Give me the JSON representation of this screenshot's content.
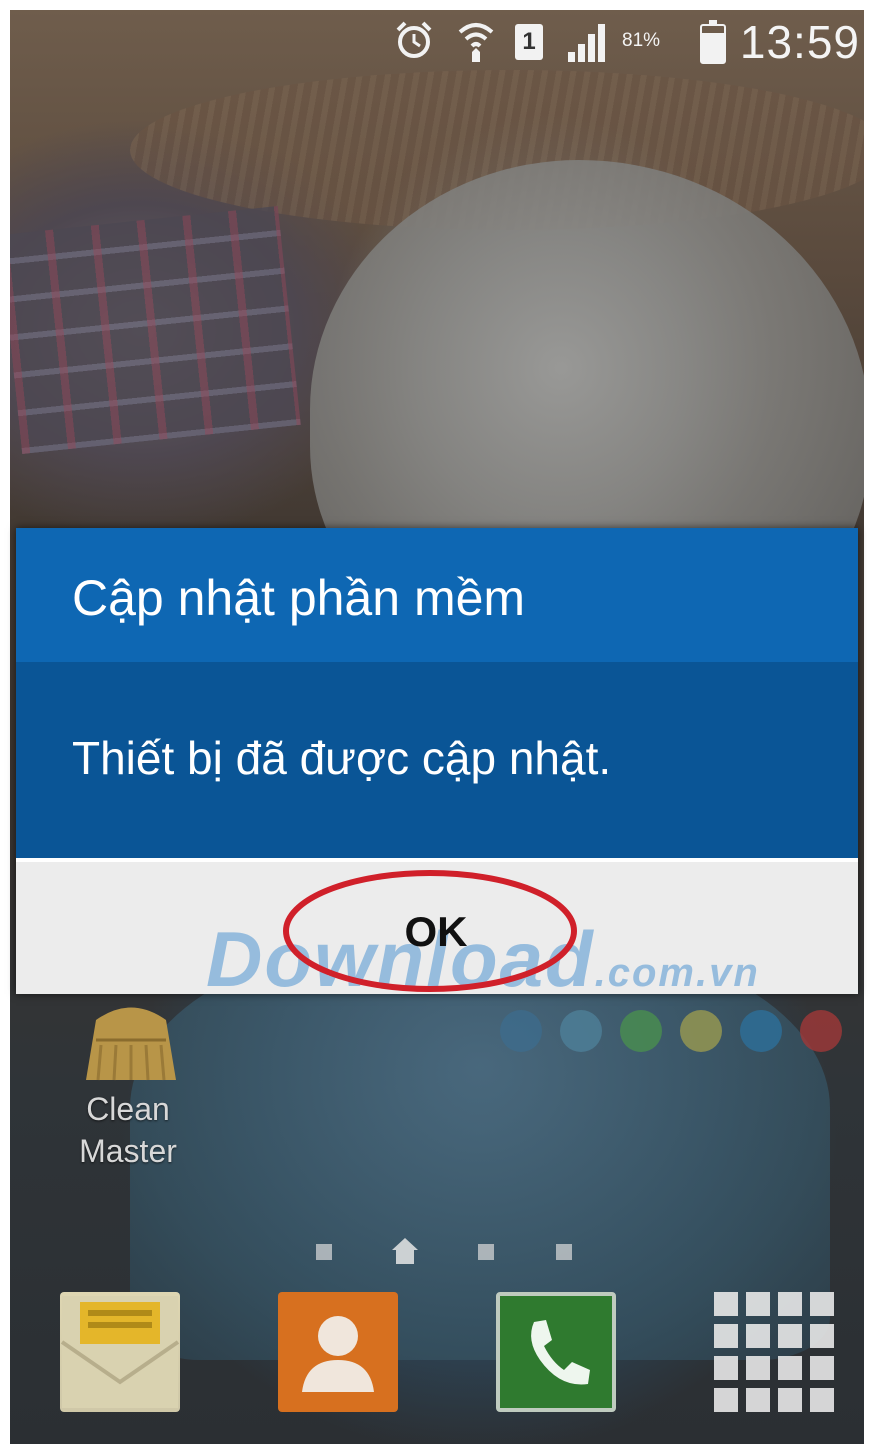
{
  "status_bar": {
    "time": "13:59",
    "battery_percent": "81%",
    "sim_label": "1",
    "icons": [
      "alarm-icon",
      "wifi-icon",
      "sim-icon",
      "signal-icon",
      "battery-icon"
    ]
  },
  "dialog": {
    "title": "Cập nhật phần mềm",
    "message": "Thiết bị đã được cập nhật.",
    "ok_label": "OK",
    "colors": {
      "header": "#0e67b3",
      "body": "#0a5596",
      "footer": "#ececec",
      "highlight": "#d0202a"
    }
  },
  "watermark": {
    "main": "Download",
    "tld": ".com.vn"
  },
  "home": {
    "page_dots": [
      "#3d6b8c",
      "#4d7f99",
      "#4a8f4f",
      "#9a9a50",
      "#2d6f9a",
      "#a03838"
    ],
    "apps": [
      {
        "label": "Clean Master",
        "icon": "broom-icon"
      }
    ],
    "dock": [
      {
        "icon": "messages-icon"
      },
      {
        "icon": "contacts-icon"
      },
      {
        "icon": "phone-icon"
      },
      {
        "icon": "apps-grid-icon"
      }
    ]
  }
}
